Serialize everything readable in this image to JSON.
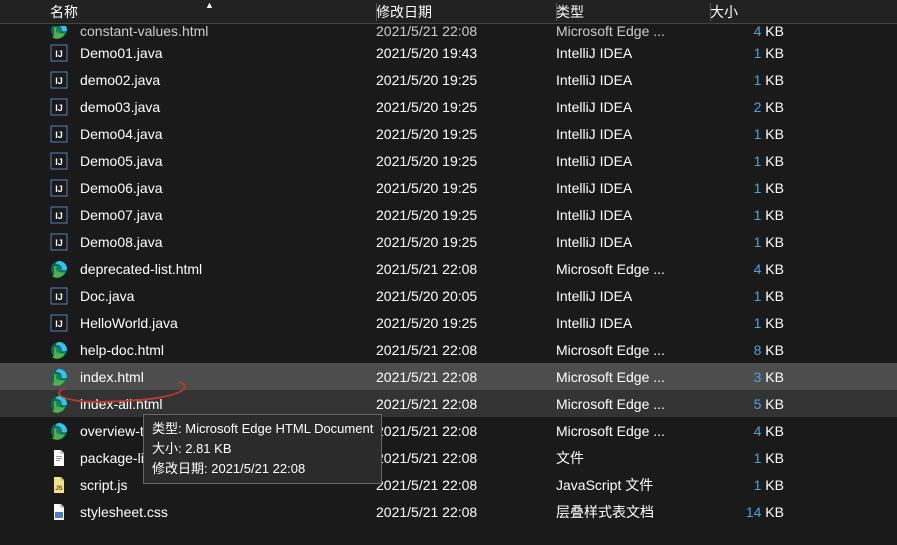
{
  "header": {
    "name": "名称",
    "date": "修改日期",
    "type": "类型",
    "size": "大小"
  },
  "icons": {
    "edge": "edge-icon",
    "intellij": "intellij-icon",
    "file": "file-icon",
    "js": "js-icon",
    "css": "css-icon"
  },
  "tooltip": {
    "line1_label": "类型: ",
    "line1_value": "Microsoft Edge HTML Document",
    "line2_label": "大小: ",
    "line2_value": "2.81 KB",
    "line3_label": "修改日期: ",
    "line3_value": "2021/5/21 22:08"
  },
  "files": [
    {
      "icon": "edge",
      "name": "constant-values.html",
      "date": "2021/5/21 22:08",
      "type": "Microsoft Edge ...",
      "sizeNum": "4",
      "sizeUnit": "KB",
      "cut": true
    },
    {
      "icon": "intellij",
      "name": "Demo01.java",
      "date": "2021/5/20 19:43",
      "type": "IntelliJ IDEA",
      "sizeNum": "1",
      "sizeUnit": "KB"
    },
    {
      "icon": "intellij",
      "name": "demo02.java",
      "date": "2021/5/20 19:25",
      "type": "IntelliJ IDEA",
      "sizeNum": "1",
      "sizeUnit": "KB"
    },
    {
      "icon": "intellij",
      "name": "demo03.java",
      "date": "2021/5/20 19:25",
      "type": "IntelliJ IDEA",
      "sizeNum": "2",
      "sizeUnit": "KB"
    },
    {
      "icon": "intellij",
      "name": "Demo04.java",
      "date": "2021/5/20 19:25",
      "type": "IntelliJ IDEA",
      "sizeNum": "1",
      "sizeUnit": "KB"
    },
    {
      "icon": "intellij",
      "name": "Demo05.java",
      "date": "2021/5/20 19:25",
      "type": "IntelliJ IDEA",
      "sizeNum": "1",
      "sizeUnit": "KB"
    },
    {
      "icon": "intellij",
      "name": "Demo06.java",
      "date": "2021/5/20 19:25",
      "type": "IntelliJ IDEA",
      "sizeNum": "1",
      "sizeUnit": "KB"
    },
    {
      "icon": "intellij",
      "name": "Demo07.java",
      "date": "2021/5/20 19:25",
      "type": "IntelliJ IDEA",
      "sizeNum": "1",
      "sizeUnit": "KB"
    },
    {
      "icon": "intellij",
      "name": "Demo08.java",
      "date": "2021/5/20 19:25",
      "type": "IntelliJ IDEA",
      "sizeNum": "1",
      "sizeUnit": "KB"
    },
    {
      "icon": "edge",
      "name": "deprecated-list.html",
      "date": "2021/5/21 22:08",
      "type": "Microsoft Edge ...",
      "sizeNum": "4",
      "sizeUnit": "KB"
    },
    {
      "icon": "intellij",
      "name": "Doc.java",
      "date": "2021/5/20 20:05",
      "type": "IntelliJ IDEA",
      "sizeNum": "1",
      "sizeUnit": "KB"
    },
    {
      "icon": "intellij",
      "name": "HelloWorld.java",
      "date": "2021/5/20 19:25",
      "type": "IntelliJ IDEA",
      "sizeNum": "1",
      "sizeUnit": "KB"
    },
    {
      "icon": "edge",
      "name": "help-doc.html",
      "date": "2021/5/21 22:08",
      "type": "Microsoft Edge ...",
      "sizeNum": "8",
      "sizeUnit": "KB"
    },
    {
      "icon": "edge",
      "name": "index.html",
      "date": "2021/5/21 22:08",
      "type": "Microsoft Edge ...",
      "sizeNum": "3",
      "sizeUnit": "KB",
      "selected": true
    },
    {
      "icon": "edge",
      "name": "index-all.html",
      "date": "2021/5/21 22:08",
      "type": "Microsoft Edge ...",
      "sizeNum": "5",
      "sizeUnit": "KB",
      "hover": true
    },
    {
      "icon": "edge",
      "name": "overview-tree.html",
      "date": "2021/5/21 22:08",
      "type": "Microsoft Edge ...",
      "sizeNum": "4",
      "sizeUnit": "KB"
    },
    {
      "icon": "file",
      "name": "package-list",
      "date": "2021/5/21 22:08",
      "type": "文件",
      "sizeNum": "1",
      "sizeUnit": "KB"
    },
    {
      "icon": "js",
      "name": "script.js",
      "date": "2021/5/21 22:08",
      "type": "JavaScript 文件",
      "sizeNum": "1",
      "sizeUnit": "KB"
    },
    {
      "icon": "css",
      "name": "stylesheet.css",
      "date": "2021/5/21 22:08",
      "type": "层叠样式表文档",
      "sizeNum": "14",
      "sizeUnit": "KB"
    }
  ]
}
